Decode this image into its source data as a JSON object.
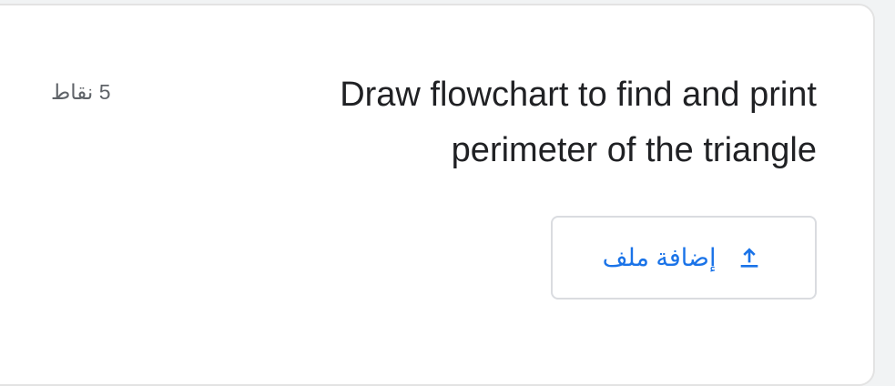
{
  "question": {
    "title": "Draw flowchart to find and print perimeter of the triangle",
    "points_label": "5 نقاط"
  },
  "upload": {
    "label": "إضافة ملف",
    "icon": "upload-icon",
    "color": "#1a73e8"
  }
}
